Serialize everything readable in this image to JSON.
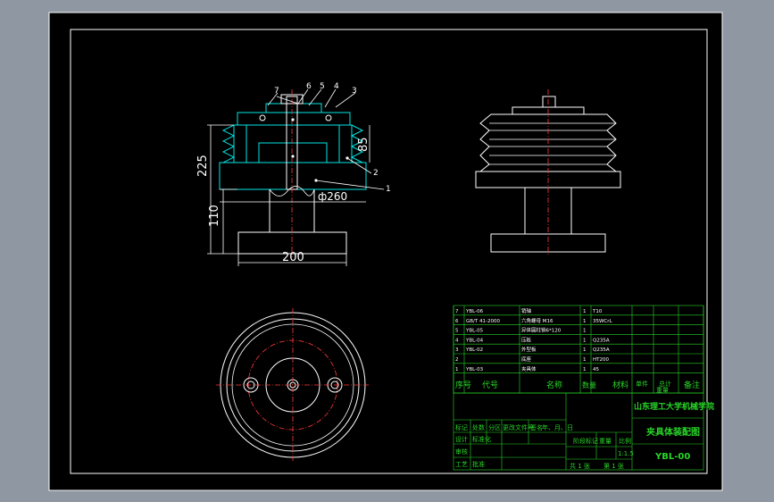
{
  "dimensions": {
    "height_total": "225",
    "height_base": "110",
    "depth": "85",
    "diameter": "ф260",
    "width": "200"
  },
  "balloons": [
    "7",
    "6",
    "5",
    "4",
    "3",
    "2",
    "1"
  ],
  "bom_rows": [
    {
      "no": "7",
      "code": "YBL-06",
      "name": "销轴",
      "qty": "1",
      "material": "T10"
    },
    {
      "no": "6",
      "code": "GB/T 41-2000",
      "name": "六角螺母 M16",
      "qty": "1",
      "material": "35WCrL"
    },
    {
      "no": "5",
      "code": "YBL-05",
      "name": "异体圆柱销6*120",
      "qty": "1",
      "material": ""
    },
    {
      "no": "4",
      "code": "YBL-04",
      "name": "压板",
      "qty": "1",
      "material": "Q235A"
    },
    {
      "no": "3",
      "code": "YBL-02",
      "name": "外型板",
      "qty": "1",
      "material": "Q235A"
    },
    {
      "no": "2",
      "code": "",
      "name": "底座",
      "qty": "1",
      "material": "HT200"
    },
    {
      "no": "1",
      "code": "YBL-03",
      "name": "夹具体",
      "qty": "1",
      "material": "45"
    }
  ],
  "bom_header": {
    "no": "序号",
    "code": "代号",
    "name": "名称",
    "qty": "数量",
    "material": "材料",
    "single": "单件",
    "total": "总计",
    "weight": "重量",
    "remarks": "备注"
  },
  "title_block": {
    "school": "山东理工大学机械学院",
    "drawing_title": "夹具体装配图",
    "drawing_no": "YBL-00",
    "scale": "1:1.5",
    "sheet_total": "共 1 张",
    "sheet_no": "第 1 张",
    "stage_label": "阶段标记",
    "weight_label": "重量",
    "scale_label": "比例",
    "mark_label": "标记",
    "count_label": "处数",
    "zone_label": "分区",
    "change_label": "更改文件号",
    "sign_label": "签名",
    "date_label": "年、月、日",
    "design_label": "设计",
    "standard_label": "标准化",
    "check_label": "审核",
    "craft_label": "工艺",
    "approve_label": "批准"
  }
}
